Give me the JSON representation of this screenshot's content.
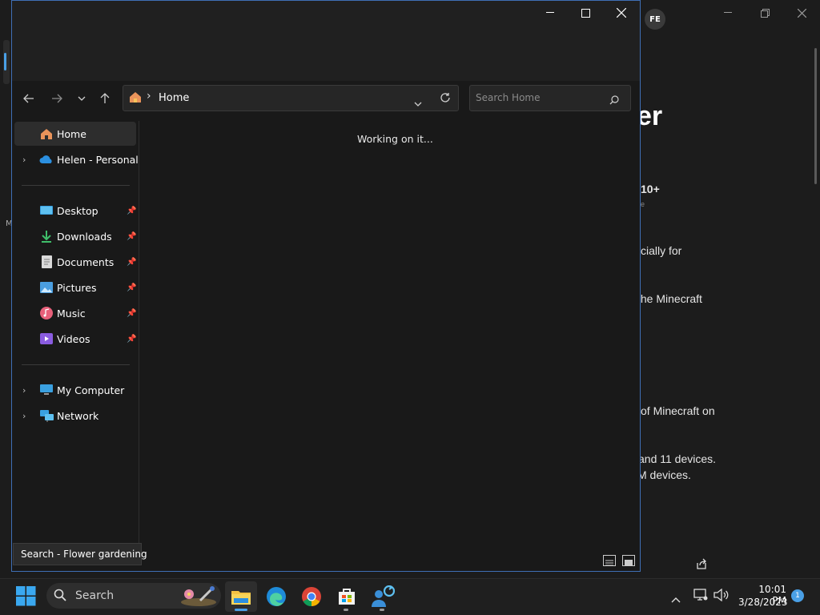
{
  "background_app": {
    "avatar": "FE",
    "heading_fragment": "er",
    "text_lines": [
      "10+",
      "e",
      "cially for",
      "the Minecraft",
      "of Minecraft on",
      "and 11 devices.",
      "M devices."
    ],
    "left_letter": "M"
  },
  "explorer": {
    "address": {
      "location": "Home"
    },
    "search": {
      "placeholder": "Search Home"
    },
    "nav": {
      "items": [
        {
          "label": "Home",
          "icon": "home-icon"
        },
        {
          "label": "Helen - Personal",
          "icon": "onedrive-cloud-icon"
        },
        {
          "label": "Desktop",
          "icon": "desktop-icon"
        },
        {
          "label": "Downloads",
          "icon": "downloads-icon"
        },
        {
          "label": "Documents",
          "icon": "documents-icon"
        },
        {
          "label": "Pictures",
          "icon": "pictures-icon"
        },
        {
          "label": "Music",
          "icon": "music-icon"
        },
        {
          "label": "Videos",
          "icon": "videos-icon"
        },
        {
          "label": "My Computer",
          "icon": "computer-icon"
        },
        {
          "label": "Network",
          "icon": "network-icon"
        }
      ]
    },
    "status_message": "Working on it..."
  },
  "tooltip": {
    "text": "Search - Flower gardening"
  },
  "taskbar": {
    "search_label": "Search",
    "apps": [
      "file-explorer-icon",
      "edge-icon",
      "chrome-icon",
      "store-icon",
      "quick-assist-icon"
    ],
    "clock": {
      "time": "10:01 PM",
      "date": "3/28/2023"
    },
    "notification_count": "1"
  },
  "colors": {
    "accent": "#4aa0e6",
    "window_border": "#3f6fb5",
    "folder_yellow": "#f3c243"
  }
}
